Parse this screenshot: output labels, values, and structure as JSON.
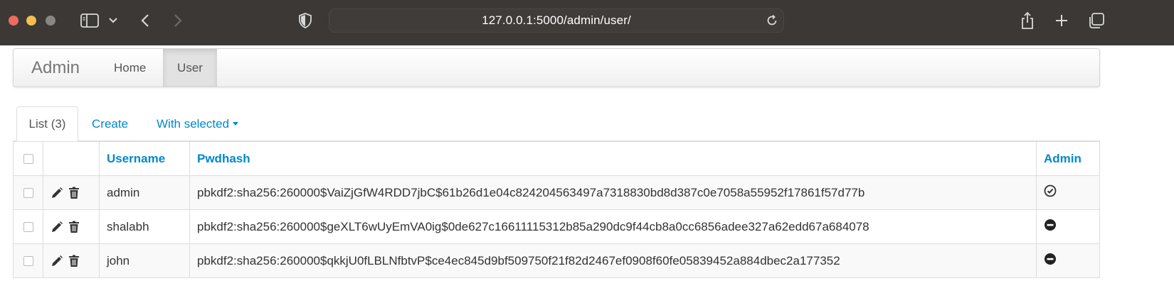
{
  "browser": {
    "url": "127.0.0.1:5000/admin/user/",
    "icons": [
      "sidebar-icon",
      "chevron-down-icon",
      "back-arrow-icon",
      "forward-arrow-icon",
      "shield-icon",
      "reload-icon",
      "share-icon",
      "new-tab-icon",
      "tabs-overview-icon"
    ]
  },
  "navbar": {
    "brand": "Admin",
    "links": [
      {
        "label": "Home",
        "active": false
      },
      {
        "label": "User",
        "active": true
      }
    ]
  },
  "tabs": {
    "list": "List (3)",
    "create": "Create",
    "with_selected": "With selected"
  },
  "table": {
    "headers": {
      "username": "Username",
      "pwdhash": "Pwdhash",
      "admin": "Admin"
    },
    "rows": [
      {
        "username": "admin",
        "pwdhash": "pbkdf2:sha256:260000$VaiZjGfW4RDD7jbC$61b26d1e04c824204563497a7318830bd8d387c0e7058a55952f17861f57d77b",
        "admin": true
      },
      {
        "username": "shalabh",
        "pwdhash": "pbkdf2:sha256:260000$geXLT6wUyEmVA0ig$0de627c16611115312b85a290dc9f44cb8a0cc6856adee327a62edd67a684078",
        "admin": false
      },
      {
        "username": "john",
        "pwdhash": "pbkdf2:sha256:260000$qkkjU0fLBLNfbtvP$ce4ec845d9bf509750f21f82d2467ef0908f60fe05839452a884dbec2a177352",
        "admin": false
      }
    ]
  },
  "colors": {
    "link": "#0088cc",
    "chrome": "#3b3835",
    "admin_true": "check-circle-icon",
    "admin_false": "minus-circle-icon"
  }
}
